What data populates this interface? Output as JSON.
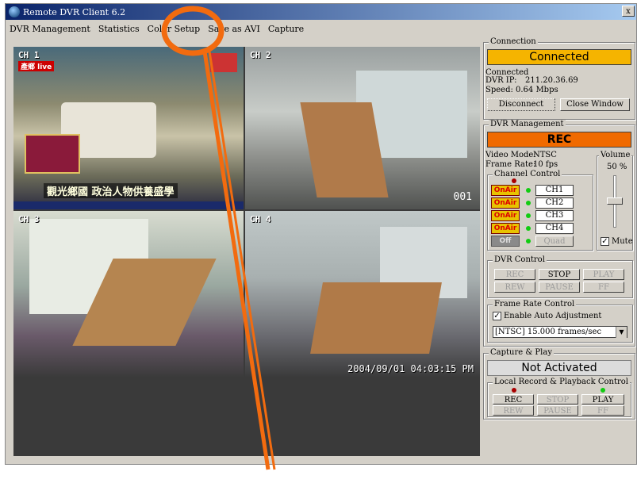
{
  "window": {
    "title": "Remote DVR Client 6.2",
    "close": "x"
  },
  "menu": [
    "DVR Management",
    "Statistics",
    "Color Setup",
    "Save as AVI",
    "Capture"
  ],
  "video": {
    "ch1_label": "CH 1",
    "ch1_live": "產鄉 live",
    "ch1_headline": "觀光鄉國 政治人物供養盛學",
    "ch2_label": "CH 2",
    "ch2_camnum": "001",
    "ch3_label": "CH 3",
    "ch4_label": "CH 4",
    "ch4_timestamp": "2004/09/01 04:03:15 PM"
  },
  "connection": {
    "group": "Connection",
    "status": "Connected",
    "state_text": "Connected",
    "ip_label": "DVR IP:",
    "ip": "211.20.36.69",
    "speed_label": "Speed:",
    "speed": "0.64 Mbps",
    "disconnect": "Disconnect",
    "close_window": "Close Window"
  },
  "dvr_mgmt": {
    "group": "DVR Management",
    "rec_status": "REC",
    "video_mode_label": "Video Mode:",
    "video_mode": "NTSC",
    "frame_rate_label": "Frame Rate:",
    "frame_rate": "10 fps",
    "volume_label": "Volume",
    "volume_value": "50 %",
    "mute": "Mute",
    "channel_control": "Channel Control",
    "onair": "OnAir",
    "off": "Off",
    "channels": [
      "CH1",
      "CH2",
      "CH3",
      "CH4"
    ],
    "quad": "Quad",
    "dvr_control": "DVR Control",
    "dvr_buttons": [
      "REC",
      "STOP",
      "PLAY",
      "REW",
      "PAUSE",
      "FF"
    ],
    "frame_rate_control": "Frame Rate Control",
    "auto_adjust": "Enable Auto Adjustment",
    "frame_select": "[NTSC] 15.000 frames/sec"
  },
  "capture": {
    "group": "Capture & Play",
    "status": "Not Activated",
    "local_group": "Local Record & Playback Control",
    "buttons": [
      "REC",
      "STOP",
      "PLAY",
      "REW",
      "PAUSE",
      "FF"
    ]
  },
  "colors": {
    "status_yellow": "#f5b400",
    "status_orange": "#f06a00",
    "annotation": "#f26b0f"
  }
}
